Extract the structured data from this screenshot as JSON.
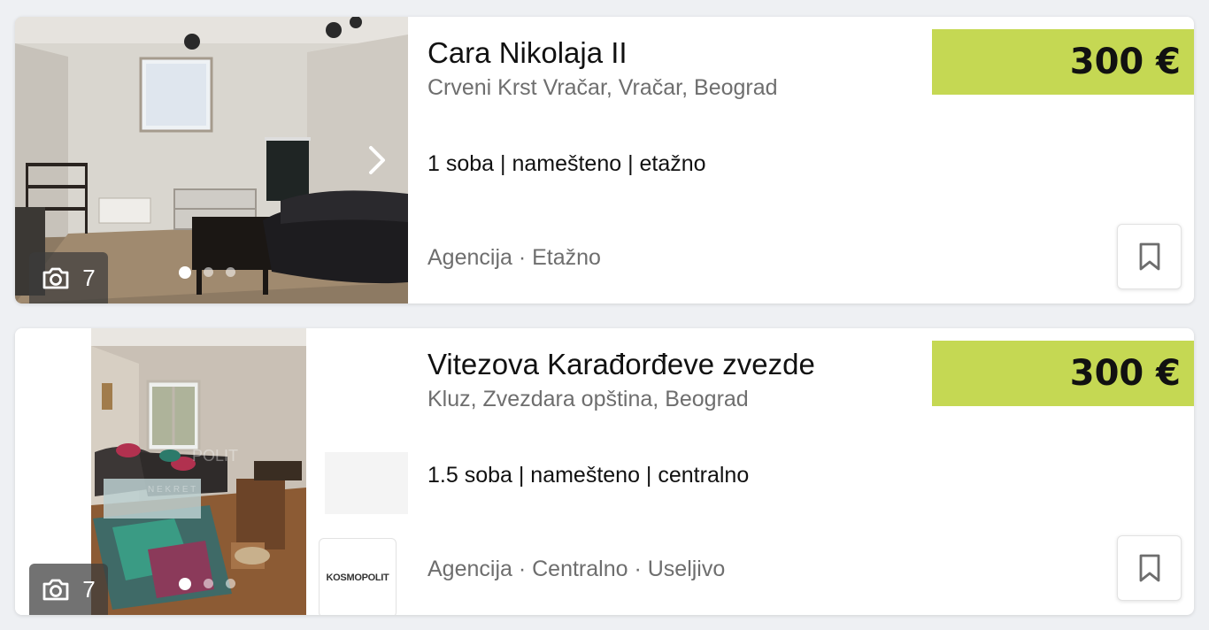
{
  "listings": [
    {
      "title": "Cara Nikolaja II",
      "location": "Crveni Krst Vračar, Vračar, Beograd",
      "features": "1 soba | namešteno | etažno",
      "meta": "Agencija · Etažno",
      "price": "300 €",
      "photo_count": "7",
      "carousel": {
        "total": 3,
        "active": 1
      }
    },
    {
      "title": "Vitezova Karađorđeve zvezde",
      "location": "Kluz, Zvezdara opština, Beograd",
      "features": "1.5 soba | namešteno | centralno",
      "meta": "Agencija · Centralno · Useljivo",
      "price": "300 €",
      "photo_count": "7",
      "agency_logo": "KOSMOPOLIT",
      "carousel": {
        "total": 3,
        "active": 1
      }
    }
  ],
  "colors": {
    "price_bg": "#c5d853",
    "page_bg": "#eef0f3"
  },
  "icons": {
    "photo_count": "camera-icon",
    "next": "chevron-right-icon",
    "save": "bookmark-icon"
  }
}
